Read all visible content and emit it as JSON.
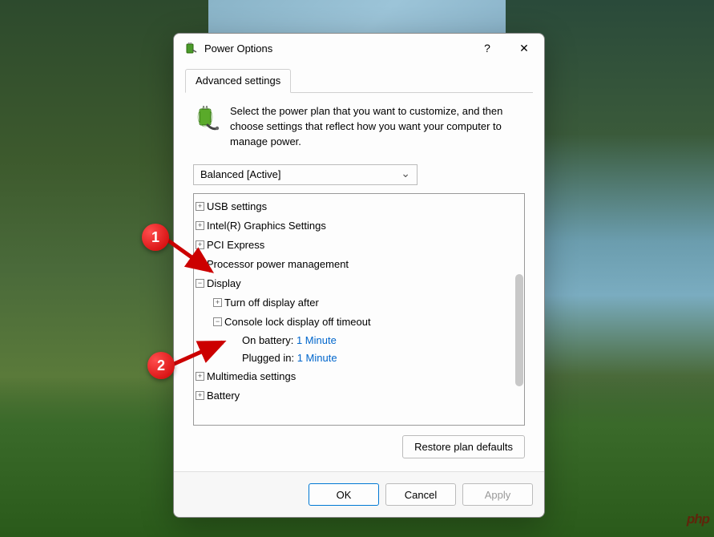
{
  "window": {
    "title": "Power Options",
    "help_symbol": "?",
    "close_symbol": "✕"
  },
  "tab": {
    "label": "Advanced settings"
  },
  "intro": {
    "text": "Select the power plan that you want to customize, and then choose settings that reflect how you want your computer to manage power."
  },
  "plan_select": {
    "value": "Balanced [Active]"
  },
  "tree": {
    "items": [
      {
        "id": "usb",
        "label": "USB settings",
        "expanded": false
      },
      {
        "id": "intel",
        "label": "Intel(R) Graphics Settings",
        "expanded": false
      },
      {
        "id": "pcie",
        "label": "PCI Express",
        "expanded": false
      },
      {
        "id": "cpu",
        "label": "Processor power management",
        "expanded": false
      },
      {
        "id": "display",
        "label": "Display",
        "expanded": true,
        "children": [
          {
            "id": "turnoff",
            "label": "Turn off display after",
            "expanded": false
          },
          {
            "id": "consolelock",
            "label": "Console lock display off timeout",
            "expanded": true,
            "leaves": [
              {
                "label": "On battery:",
                "value": "1 Minute"
              },
              {
                "label": "Plugged in:",
                "value": "1 Minute"
              }
            ]
          }
        ]
      },
      {
        "id": "multimedia",
        "label": "Multimedia settings",
        "expanded": false
      },
      {
        "id": "battery",
        "label": "Battery",
        "expanded": false
      }
    ]
  },
  "buttons": {
    "restore": "Restore plan defaults",
    "ok": "OK",
    "cancel": "Cancel",
    "apply": "Apply"
  },
  "annotations": {
    "one": "1",
    "two": "2"
  },
  "watermark": "php"
}
